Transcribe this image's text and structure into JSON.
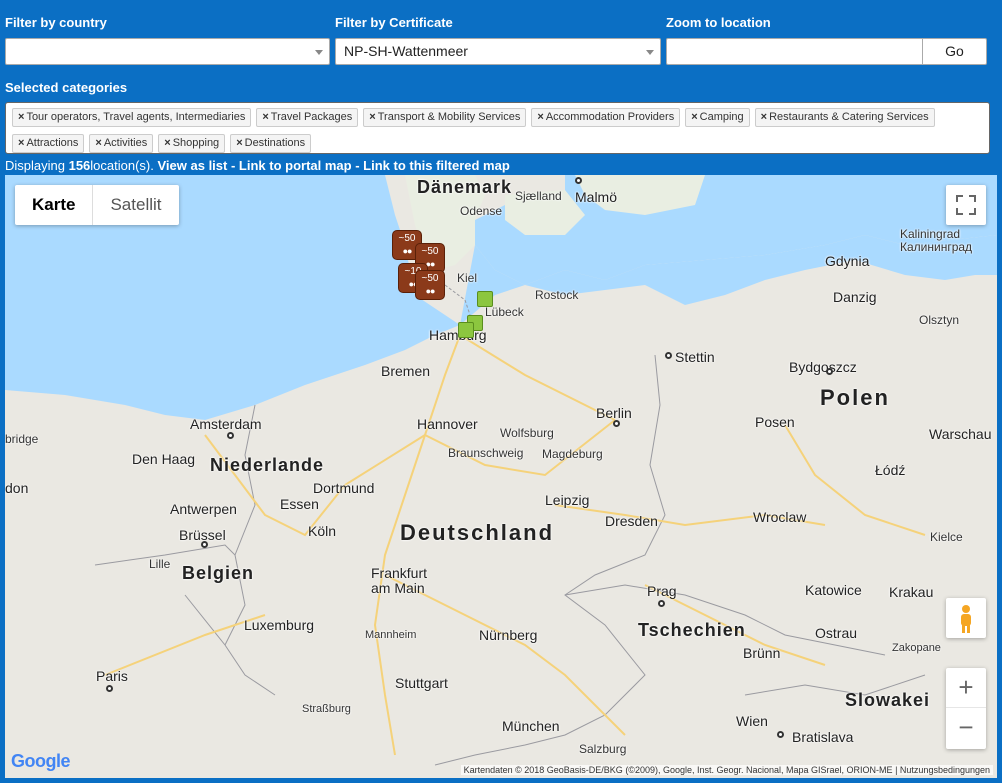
{
  "filters": {
    "country_label": "Filter by country",
    "country_value": "",
    "certificate_label": "Filter by Certificate",
    "certificate_value": "NP-SH-Wattenmeer",
    "zoom_label": "Zoom to location",
    "zoom_value": "",
    "go_label": "Go"
  },
  "categories": {
    "label": "Selected categories",
    "chips": [
      "Tour operators, Travel agents, Intermediaries",
      "Travel Packages",
      "Transport & Mobility Services",
      "Accommodation Providers",
      "Camping",
      "Restaurants & Catering Services",
      "Attractions",
      "Activities",
      "Shopping",
      "Destinations"
    ],
    "remove_glyph": "×"
  },
  "info": {
    "prefix": "Displaying ",
    "count": "156",
    "suffix": "location(s). ",
    "view_list": "View as list",
    "sep": " - ",
    "portal_map": "Link to portal map",
    "filtered_map": "Link to this filtered map"
  },
  "map": {
    "maptype_map": "Karte",
    "maptype_satellite": "Satellit",
    "fullscreen_icon": "fullscreen-icon",
    "pegman_icon": "pegman-icon",
    "zoom_in": "+",
    "zoom_out": "−",
    "google": "Google",
    "attribution": "Kartendaten © 2018 GeoBasis-DE/BKG (©2009), Google, Inst. Geogr. Nacional, Mapa GISrael, ORION-ME",
    "terms": "Nutzungsbedingungen",
    "clusters": [
      "~50",
      "~50",
      "~10",
      "~50"
    ],
    "places": {
      "daenemark": "Dänemark",
      "sjaelland": "Sjælland",
      "malmoe": "Malmö",
      "odense": "Odense",
      "gdynia": "Gdynia",
      "kaliningrad": "Kaliningrad\nКалининград",
      "danzig": "Danzig",
      "olsztyn": "Olsztyn",
      "kiel": "Kiel",
      "rostock": "Rostock",
      "luebeck": "Lübeck",
      "hamburg": "Hamburg",
      "stettin": "Stettin",
      "bydgoszcz": "Bydgoszcz",
      "bremen": "Bremen",
      "polen": "Polen",
      "amsterdam": "Amsterdam",
      "berlin": "Berlin",
      "posen": "Posen",
      "warschau": "Warschau",
      "bridge": "bridge",
      "hannover": "Hannover",
      "wolfsburg": "Wolfsburg",
      "denhaag": "Den Haag",
      "niederlande": "Niederlande",
      "braunschweig": "Braunschweig",
      "magdeburg": "Magdeburg",
      "lodz": "Łódź",
      "don": "don",
      "dortmund": "Dortmund",
      "essen": "Essen",
      "leipzig": "Leipzig",
      "antwerpen": "Antwerpen",
      "deutschland": "Deutschland",
      "dresden": "Dresden",
      "wroclaw": "Wroclaw",
      "koeln": "Köln",
      "bruessel": "Brüssel",
      "kielce": "Kielce",
      "lille": "Lille",
      "belgien": "Belgien",
      "frankfurt": "Frankfurt\nam Main",
      "prag": "Prag",
      "katowice": "Katowice",
      "krakau": "Krakau",
      "luxemburg": "Luxemburg",
      "tschechien": "Tschechien",
      "ostrau": "Ostrau",
      "mannheim": "Mannheim",
      "nuernberg": "Nürnberg",
      "zakopane": "Zakopane",
      "bruenn": "Brünn",
      "paris": "Paris",
      "stuttgart": "Stuttgart",
      "slowakei": "Slowakei",
      "strassburg": "Straßburg",
      "muenchen": "München",
      "wien": "Wien",
      "bratislava": "Bratislava",
      "salzburg": "Salzburg"
    }
  },
  "colors": {
    "header_bg": "#0b6fc4",
    "cluster": "#8b3a1a",
    "green_marker": "#8cc63f",
    "water": "#aadaff"
  }
}
